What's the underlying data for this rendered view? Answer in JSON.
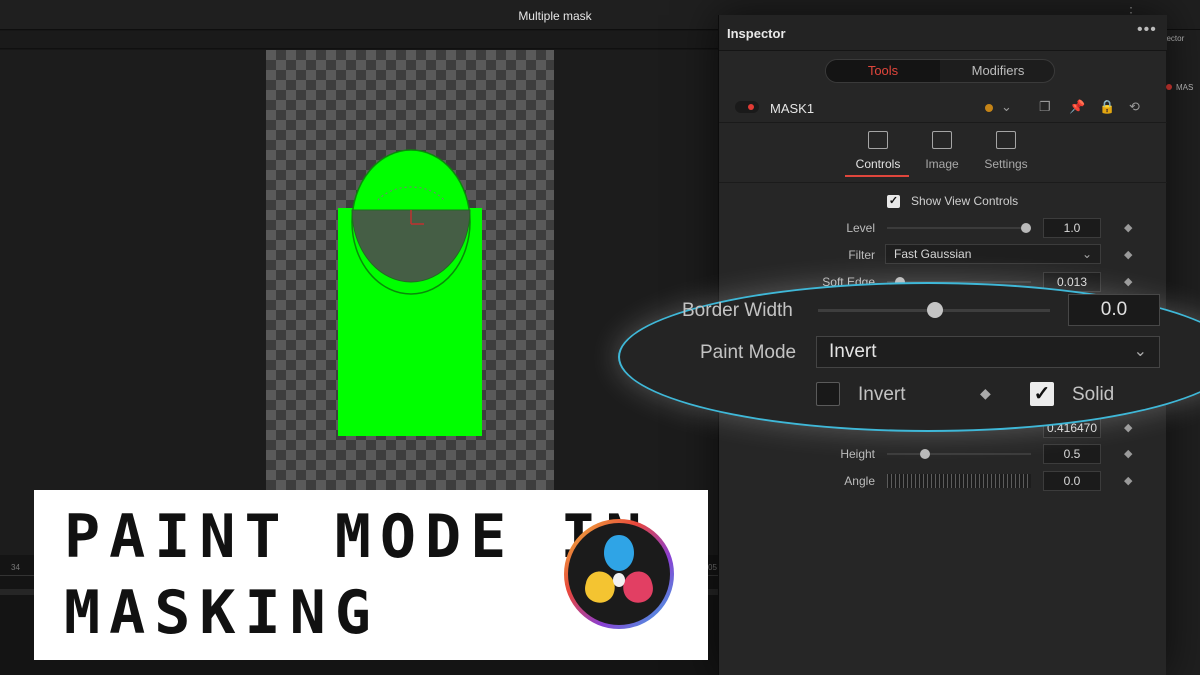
{
  "viewer": {
    "title": "Multiple mask"
  },
  "timeline": {
    "ticks": [
      "34",
      "05"
    ]
  },
  "inspector": {
    "title": "Inspector",
    "more": "•••",
    "tabs": {
      "tools": "Tools",
      "modifiers": "Modifiers"
    },
    "node": {
      "name": "MASK1"
    },
    "subtabs": {
      "controls": "Controls",
      "image": "Image",
      "settings": "Settings"
    },
    "show_view_controls": "Show View Controls",
    "controls": {
      "level": {
        "label": "Level",
        "value": "1.0"
      },
      "filter": {
        "label": "Filter",
        "value": "Fast Gaussian"
      },
      "soft_edge": {
        "label": "Soft Edge",
        "value": "0.013"
      },
      "width_value": "0.416470",
      "height": {
        "label": "Height",
        "value": "0.5"
      },
      "angle": {
        "label": "Angle",
        "value": "0.0"
      }
    },
    "accent_color": "#e0463c"
  },
  "zoom": {
    "border_width": {
      "label": "Border Width",
      "value": "0.0"
    },
    "paint_mode": {
      "label": "Paint Mode",
      "value": "Invert"
    },
    "invert": {
      "label": "Invert",
      "checked": false
    },
    "solid": {
      "label": "Solid",
      "checked": true
    },
    "highlight_color": "#3fb8d8"
  },
  "title_card": {
    "line1": "PAINT MODE IN",
    "line2": "MASKING"
  },
  "right_strip": {
    "label": "pector",
    "node": "MAS"
  },
  "mask_color": "#00ff00"
}
